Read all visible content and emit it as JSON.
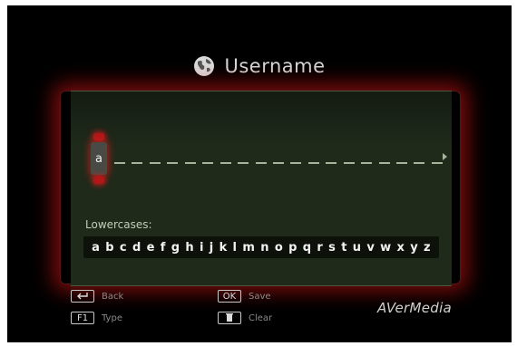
{
  "header": {
    "title": "Username",
    "icon": "globe-icon"
  },
  "editor": {
    "current_char": "a",
    "cursor_up_icon": "arrow-up-icon",
    "cursor_down_icon": "arrow-down-icon",
    "scroll_right_icon": "arrow-right-icon"
  },
  "keyboard": {
    "label": "Lowercases:",
    "letters": [
      "a",
      "b",
      "c",
      "d",
      "e",
      "f",
      "g",
      "h",
      "i",
      "j",
      "k",
      "l",
      "m",
      "n",
      "o",
      "p",
      "q",
      "r",
      "s",
      "t",
      "u",
      "v",
      "w",
      "x",
      "y",
      "z"
    ]
  },
  "footer": {
    "back": {
      "key_icon": "return-icon",
      "label": "Back"
    },
    "ok": {
      "key": "OK",
      "label": "Save"
    },
    "f1": {
      "key": "F1",
      "label": "Type"
    },
    "clear": {
      "key_icon": "trash-icon",
      "label": "Clear"
    },
    "brand": "AVerMedia"
  },
  "colors": {
    "background": "#000000",
    "panel": "#1f2a1b",
    "glow": "#dc1414",
    "text": "#d6d6d6"
  }
}
